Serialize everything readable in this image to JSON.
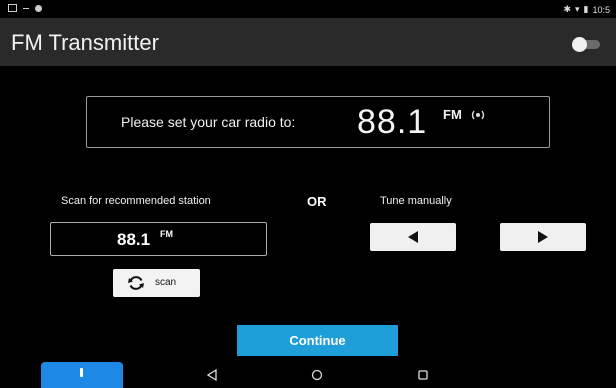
{
  "status_bar": {
    "time": "10:5",
    "left_icons": [
      "notification-icon",
      "minus-icon",
      "android-icon"
    ],
    "right_icons": [
      "bluetooth-icon",
      "wifi-icon",
      "battery-icon"
    ]
  },
  "app_bar": {
    "title": "FM Transmitter",
    "toggle_on": false
  },
  "frequency_panel": {
    "prompt": "Please set your car radio to:",
    "frequency": "88.1",
    "band": "FM",
    "icon": "radio-waves-icon"
  },
  "scan_section": {
    "label": "Scan for recommended station",
    "station_frequency": "88.1",
    "station_band": "FM",
    "scan_button_label": "scan",
    "scan_icon": "refresh-icon"
  },
  "or_label": "OR",
  "tune_section": {
    "label": "Tune manually",
    "left_icon": "triangle-left-icon",
    "right_icon": "triangle-right-icon"
  },
  "continue_button": {
    "label": "Continue"
  },
  "navigation": {
    "icons": [
      "back-icon",
      "home-icon",
      "recents-icon"
    ]
  },
  "colors": {
    "background": "#000000",
    "app_bar": "#2a2a2a",
    "accent": "#1e9fd9",
    "button_light": "#f0f0f0"
  }
}
